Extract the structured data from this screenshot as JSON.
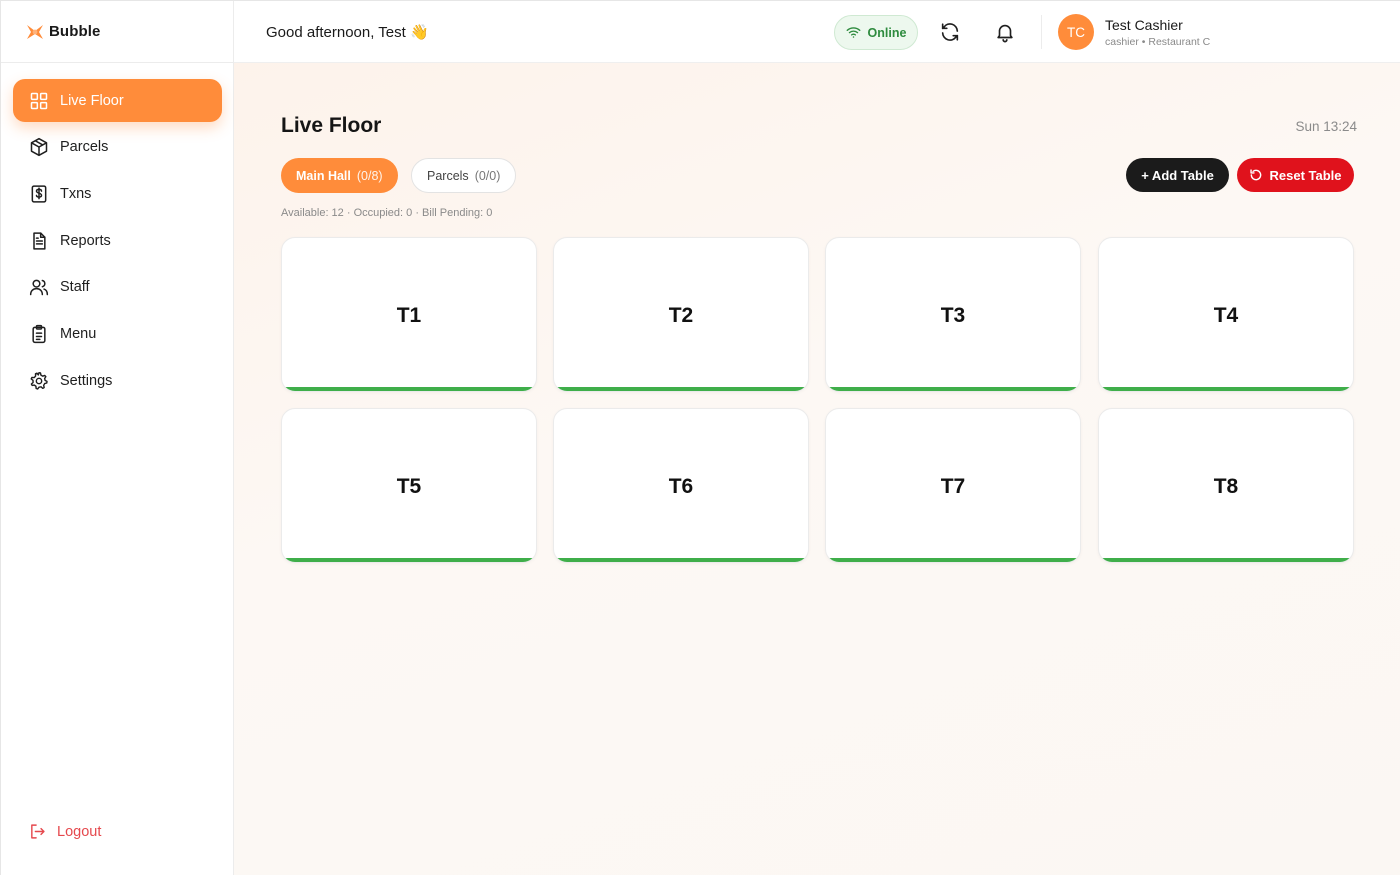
{
  "brand": {
    "name": "Bubble",
    "logo_icon": "bubble-logo-icon",
    "accent": "#ff8c3a"
  },
  "sidebar": {
    "items": [
      {
        "label": "Live Floor",
        "icon": "grid-icon",
        "active": true
      },
      {
        "label": "Parcels",
        "icon": "package-icon",
        "active": false
      },
      {
        "label": "Txns",
        "icon": "dollar-receipt-icon",
        "active": false
      },
      {
        "label": "Reports",
        "icon": "document-icon",
        "active": false
      },
      {
        "label": "Staff",
        "icon": "users-icon",
        "active": false
      },
      {
        "label": "Menu",
        "icon": "clipboard-icon",
        "active": false
      },
      {
        "label": "Settings",
        "icon": "gear-icon",
        "active": false
      }
    ],
    "logout_label": "Logout"
  },
  "header": {
    "greeting": "Good afternoon, Test 👋",
    "status_label": "Online",
    "status_color": "#2e8b3e",
    "user": {
      "initials": "TC",
      "name": "Test Cashier",
      "meta": "cashier • Restaurant C"
    }
  },
  "page": {
    "title": "Live Floor",
    "clock": "Sun 13:24",
    "tabs": [
      {
        "label": "Main Hall",
        "count": "(0/8)",
        "active": true
      },
      {
        "label": "Parcels",
        "count": "(0/0)",
        "active": false
      }
    ],
    "add_table_label": "+ Add Table",
    "reset_table_label": "Reset Table",
    "summary": "Available: 12 · Occupied: 0 · Bill Pending: 0",
    "available_color": "#3fae4a",
    "tables": [
      {
        "label": "T1",
        "status": "available"
      },
      {
        "label": "T2",
        "status": "available"
      },
      {
        "label": "T3",
        "status": "available"
      },
      {
        "label": "T4",
        "status": "available"
      },
      {
        "label": "T5",
        "status": "available"
      },
      {
        "label": "T6",
        "status": "available"
      },
      {
        "label": "T7",
        "status": "available"
      },
      {
        "label": "T8",
        "status": "available"
      }
    ]
  }
}
